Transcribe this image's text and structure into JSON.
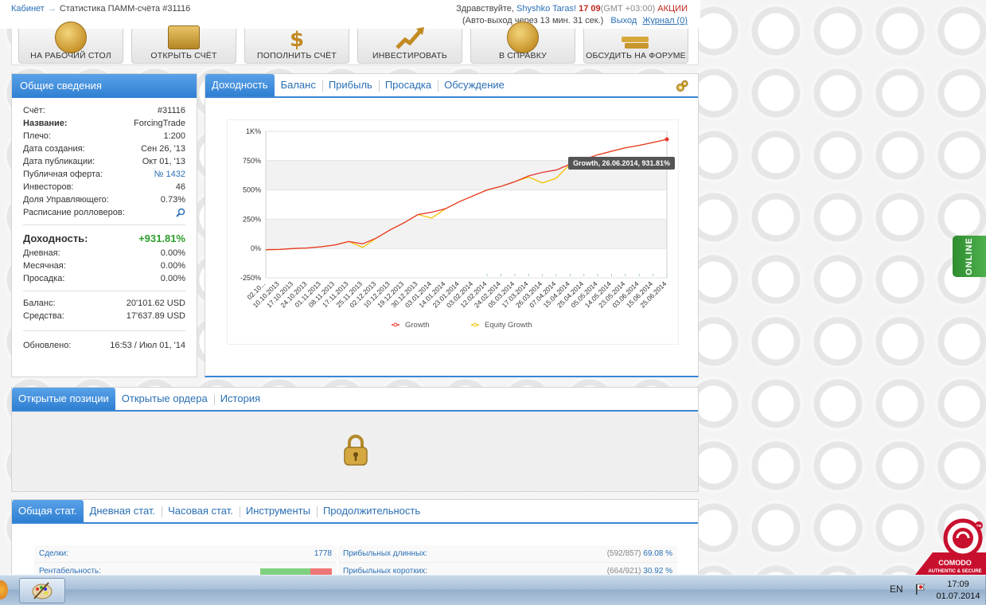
{
  "breadcrumb": {
    "home": "Кабинет",
    "separator": "→",
    "current": "Статистика ПАММ-счёта #31116"
  },
  "user": {
    "greeting": "Здравствуйте,",
    "name": "Shyshko Taras!",
    "time": "17 09",
    "timezone": "(GMT +03:00)",
    "promo": "АКЦИИ",
    "autologout": "(Авто-выход через 13 мин. 31 сек.)",
    "logout": "Выход",
    "journal": "Журнал (0)"
  },
  "toolbar": [
    {
      "label": "НА РАБОЧИЙ СТОЛ",
      "icon": "desktop-coin-icon"
    },
    {
      "label": "ОТКРЫТЬ СЧЁТ",
      "icon": "open-account-icon"
    },
    {
      "label": "ПОПОЛНИТЬ СЧЁТ",
      "icon": "dollar-coin-icon"
    },
    {
      "label": "ИНВЕСТИРОВАТЬ",
      "icon": "invest-chart-icon"
    },
    {
      "label": "В СПРАВКУ",
      "icon": "help-coin-icon"
    },
    {
      "label": "ОБСУДИТЬ НА ФОРУМЕ",
      "icon": "forum-icon"
    }
  ],
  "info": {
    "title": "Общие сведения",
    "rows": [
      {
        "label": "Счёт:",
        "value": "#31116",
        "bold": false
      },
      {
        "label": "Название:",
        "value": "ForcingTrade",
        "bold": true
      },
      {
        "label": "Плечо:",
        "value": "1:200",
        "bold": false
      },
      {
        "label": "Дата создания:",
        "value": "Сен 26, '13",
        "bold": false
      },
      {
        "label": "Дата публикации:",
        "value": "Окт 01, '13",
        "bold": false
      },
      {
        "label": "Публичная оферта:",
        "value": "№ 1432",
        "bold": false,
        "link": true
      },
      {
        "label": "Инвесторов:",
        "value": "46",
        "bold": false
      },
      {
        "label": "Доля Управляющего:",
        "value": "0.73%",
        "bold": false
      },
      {
        "label": "Расписание ролловеров:",
        "value": "",
        "bold": false,
        "icon": "search-icon"
      }
    ],
    "profit_label": "Доходность:",
    "profit_value": "+931.81%",
    "profit_rows": [
      {
        "label": "Дневная:",
        "value": "0.00%"
      },
      {
        "label": "Месячная:",
        "value": "0.00%"
      },
      {
        "label": "Просадка:",
        "value": "0.00%"
      }
    ],
    "balance_rows": [
      {
        "label": "Баланс:",
        "value": "20'101.62 USD"
      },
      {
        "label": "Средства:",
        "value": "17'637.89 USD"
      }
    ],
    "updated_label": "Обновлено:",
    "updated_value": "16:53 / Июл 01, '14"
  },
  "chart_tabs": [
    "Доходность",
    "Баланс",
    "Прибыль",
    "Просадка",
    "Обсуждение"
  ],
  "position_tabs": [
    "Открытые позиции",
    "Открытые ордера",
    "История"
  ],
  "stat_tabs": [
    "Общая стат.",
    "Дневная стат.",
    "Часовая стат.",
    "Инструменты",
    "Продолжительность"
  ],
  "stats": {
    "left": [
      {
        "label": "Сделки:",
        "value": "1778"
      },
      {
        "label": "Рентабельность:",
        "value": "",
        "bar": true,
        "bar_green_fraction": 0.7
      }
    ],
    "right": [
      {
        "label": "Прибыльных длинных:",
        "muted": "(592/857)",
        "value": "69.08 %"
      },
      {
        "label": "Прибыльных коротких:",
        "muted": "(664/921)",
        "value": "30.92 %"
      }
    ]
  },
  "online_label": "ONLINE",
  "comodo": {
    "name": "COMODO",
    "tagline": "AUTHENTIC & SECURE",
    "tm": "TM"
  },
  "taskbar": {
    "lang": "EN",
    "time": "17:09",
    "date": "01.07.2014"
  },
  "colors": {
    "accent": "#3a86d6",
    "growth": "#e8362d",
    "equity": "#f2c200",
    "positive": "#2e9d2e",
    "alert": "#c0271e"
  },
  "chart_data": {
    "type": "line",
    "title": "",
    "xlabel": "",
    "ylabel": "",
    "ylim": [
      -250,
      1000
    ],
    "y_ticks": [
      "-250%",
      "0%",
      "250%",
      "500%",
      "750%",
      "1K%"
    ],
    "x_ticks": [
      "02.10...",
      "10.10.2013",
      "17.10.2013",
      "24.10.2013",
      "01.11.2013",
      "08.11.2013",
      "17.11.2013",
      "25.11.2013",
      "02.12.2013",
      "10.12.2013",
      "19.12.2013",
      "30.12.2013",
      "03.01.2014",
      "14.01.2014",
      "23.01.2014",
      "03.02.2014",
      "12.02.2014",
      "24.02.2014",
      "05.03.2014",
      "17.03.2014",
      "26.03.2014",
      "07.04.2014",
      "15.04.2014",
      "25.04.2014",
      "05.05.2014",
      "14.05.2014",
      "23.05.2014",
      "03.06.2014",
      "15.06.2014",
      "25.06.2014"
    ],
    "legend": "bottom",
    "tooltip": "Growth, 26.06.2014, 931.81%",
    "series": [
      {
        "name": "Growth",
        "color": "#e8362d",
        "values": [
          -10,
          -8,
          0,
          5,
          15,
          30,
          60,
          40,
          90,
          160,
          220,
          290,
          310,
          340,
          400,
          450,
          500,
          530,
          570,
          620,
          650,
          670,
          720,
          760,
          800,
          830,
          860,
          880,
          905,
          931.81
        ]
      },
      {
        "name": "Equity Growth",
        "color": "#f2c200",
        "values": [
          -10,
          -8,
          0,
          5,
          15,
          30,
          60,
          10,
          90,
          160,
          220,
          290,
          260,
          340,
          400,
          450,
          500,
          530,
          570,
          610,
          560,
          600,
          720,
          760,
          800,
          830,
          860,
          880,
          905,
          931.81
        ]
      }
    ]
  }
}
